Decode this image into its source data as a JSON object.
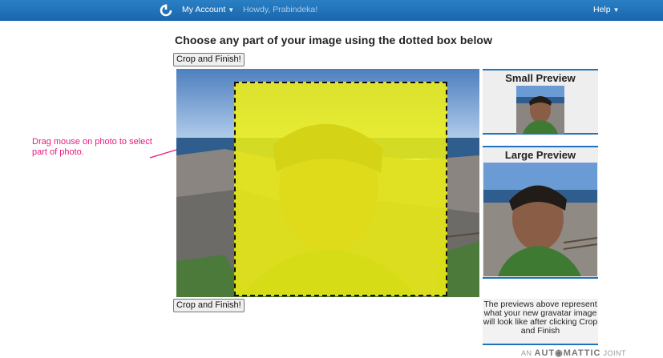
{
  "topbar": {
    "logo_icon": "gravatar-power-icon",
    "my_account": "My Account",
    "greeting": "Howdy, Prabindeka!",
    "help": "Help"
  },
  "heading": "Choose any part of your image using the dotted box below",
  "crop_button_label": "Crop and Finish!",
  "annotation": "Drag mouse on photo to select part of photo.",
  "small_preview": {
    "title": "Small Preview"
  },
  "large_preview": {
    "title": "Large Preview"
  },
  "preview_note": "The previews above represent what your new gravatar image will look like after clicking Crop and Finish",
  "footer": {
    "prefix": "AN",
    "brand": "AUT◉MATTIC",
    "suffix": "JOINT"
  },
  "colors": {
    "topbar": "#1e73be",
    "selection": "#f0f014",
    "annotation": "#e8197d"
  }
}
